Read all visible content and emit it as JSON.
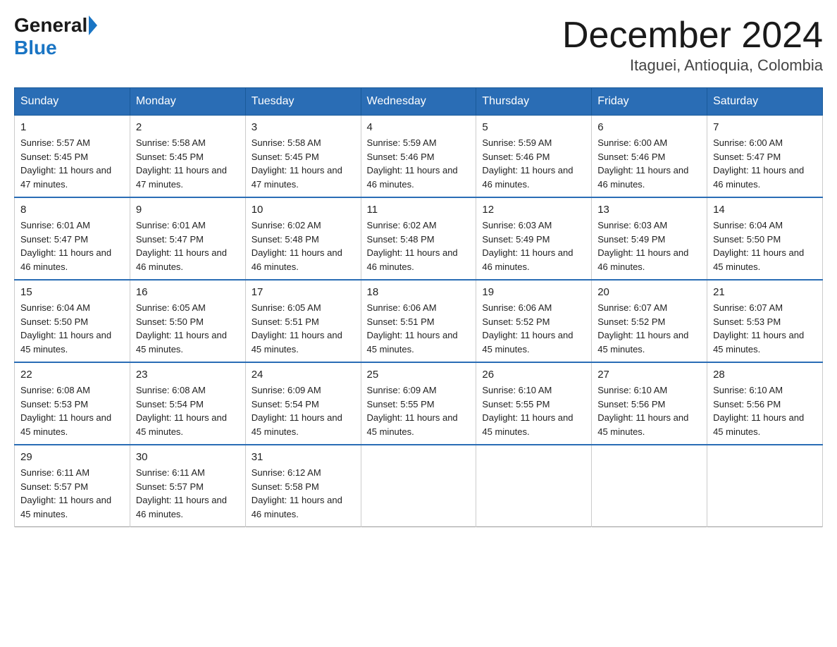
{
  "logo": {
    "general": "General",
    "blue": "Blue"
  },
  "title": "December 2024",
  "location": "Itaguei, Antioquia, Colombia",
  "headers": [
    "Sunday",
    "Monday",
    "Tuesday",
    "Wednesday",
    "Thursday",
    "Friday",
    "Saturday"
  ],
  "weeks": [
    [
      {
        "day": "1",
        "sunrise": "5:57 AM",
        "sunset": "5:45 PM",
        "daylight": "11 hours and 47 minutes."
      },
      {
        "day": "2",
        "sunrise": "5:58 AM",
        "sunset": "5:45 PM",
        "daylight": "11 hours and 47 minutes."
      },
      {
        "day": "3",
        "sunrise": "5:58 AM",
        "sunset": "5:45 PM",
        "daylight": "11 hours and 47 minutes."
      },
      {
        "day": "4",
        "sunrise": "5:59 AM",
        "sunset": "5:46 PM",
        "daylight": "11 hours and 46 minutes."
      },
      {
        "day": "5",
        "sunrise": "5:59 AM",
        "sunset": "5:46 PM",
        "daylight": "11 hours and 46 minutes."
      },
      {
        "day": "6",
        "sunrise": "6:00 AM",
        "sunset": "5:46 PM",
        "daylight": "11 hours and 46 minutes."
      },
      {
        "day": "7",
        "sunrise": "6:00 AM",
        "sunset": "5:47 PM",
        "daylight": "11 hours and 46 minutes."
      }
    ],
    [
      {
        "day": "8",
        "sunrise": "6:01 AM",
        "sunset": "5:47 PM",
        "daylight": "11 hours and 46 minutes."
      },
      {
        "day": "9",
        "sunrise": "6:01 AM",
        "sunset": "5:47 PM",
        "daylight": "11 hours and 46 minutes."
      },
      {
        "day": "10",
        "sunrise": "6:02 AM",
        "sunset": "5:48 PM",
        "daylight": "11 hours and 46 minutes."
      },
      {
        "day": "11",
        "sunrise": "6:02 AM",
        "sunset": "5:48 PM",
        "daylight": "11 hours and 46 minutes."
      },
      {
        "day": "12",
        "sunrise": "6:03 AM",
        "sunset": "5:49 PM",
        "daylight": "11 hours and 46 minutes."
      },
      {
        "day": "13",
        "sunrise": "6:03 AM",
        "sunset": "5:49 PM",
        "daylight": "11 hours and 46 minutes."
      },
      {
        "day": "14",
        "sunrise": "6:04 AM",
        "sunset": "5:50 PM",
        "daylight": "11 hours and 45 minutes."
      }
    ],
    [
      {
        "day": "15",
        "sunrise": "6:04 AM",
        "sunset": "5:50 PM",
        "daylight": "11 hours and 45 minutes."
      },
      {
        "day": "16",
        "sunrise": "6:05 AM",
        "sunset": "5:50 PM",
        "daylight": "11 hours and 45 minutes."
      },
      {
        "day": "17",
        "sunrise": "6:05 AM",
        "sunset": "5:51 PM",
        "daylight": "11 hours and 45 minutes."
      },
      {
        "day": "18",
        "sunrise": "6:06 AM",
        "sunset": "5:51 PM",
        "daylight": "11 hours and 45 minutes."
      },
      {
        "day": "19",
        "sunrise": "6:06 AM",
        "sunset": "5:52 PM",
        "daylight": "11 hours and 45 minutes."
      },
      {
        "day": "20",
        "sunrise": "6:07 AM",
        "sunset": "5:52 PM",
        "daylight": "11 hours and 45 minutes."
      },
      {
        "day": "21",
        "sunrise": "6:07 AM",
        "sunset": "5:53 PM",
        "daylight": "11 hours and 45 minutes."
      }
    ],
    [
      {
        "day": "22",
        "sunrise": "6:08 AM",
        "sunset": "5:53 PM",
        "daylight": "11 hours and 45 minutes."
      },
      {
        "day": "23",
        "sunrise": "6:08 AM",
        "sunset": "5:54 PM",
        "daylight": "11 hours and 45 minutes."
      },
      {
        "day": "24",
        "sunrise": "6:09 AM",
        "sunset": "5:54 PM",
        "daylight": "11 hours and 45 minutes."
      },
      {
        "day": "25",
        "sunrise": "6:09 AM",
        "sunset": "5:55 PM",
        "daylight": "11 hours and 45 minutes."
      },
      {
        "day": "26",
        "sunrise": "6:10 AM",
        "sunset": "5:55 PM",
        "daylight": "11 hours and 45 minutes."
      },
      {
        "day": "27",
        "sunrise": "6:10 AM",
        "sunset": "5:56 PM",
        "daylight": "11 hours and 45 minutes."
      },
      {
        "day": "28",
        "sunrise": "6:10 AM",
        "sunset": "5:56 PM",
        "daylight": "11 hours and 45 minutes."
      }
    ],
    [
      {
        "day": "29",
        "sunrise": "6:11 AM",
        "sunset": "5:57 PM",
        "daylight": "11 hours and 45 minutes."
      },
      {
        "day": "30",
        "sunrise": "6:11 AM",
        "sunset": "5:57 PM",
        "daylight": "11 hours and 46 minutes."
      },
      {
        "day": "31",
        "sunrise": "6:12 AM",
        "sunset": "5:58 PM",
        "daylight": "11 hours and 46 minutes."
      },
      null,
      null,
      null,
      null
    ]
  ]
}
